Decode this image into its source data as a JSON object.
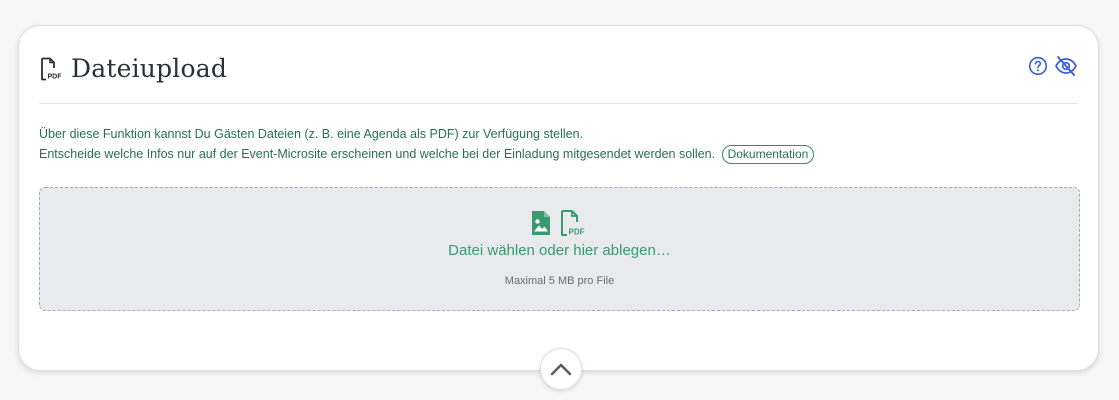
{
  "header": {
    "title": "Dateiupload",
    "title_icon": "pdf-file-icon",
    "help_icon": "help-circle-icon",
    "visibility_icon": "eye-off-icon"
  },
  "description": {
    "line1": "Über diese Funktion kannst Du Gästen Dateien (z. B. eine Agenda als PDF) zur Verfügung stellen.",
    "line2": "Entscheide welche Infos nur auf der Event-Microsite erscheinen und welche bei der Einladung mitgesendet werden sollen.",
    "doc_link": "Dokumentation"
  },
  "dropzone": {
    "label": "Datei wählen oder hier ablegen…",
    "hint": "Maximal 5 MB pro File",
    "icons": [
      "image-file-icon",
      "pdf-file-icon"
    ]
  },
  "collapse": {
    "icon": "chevron-up-icon"
  },
  "colors": {
    "accent_green": "#3a9a70",
    "text_green": "#2a6e57",
    "accent_blue": "#3b5bdb",
    "title": "#2b2f36"
  }
}
